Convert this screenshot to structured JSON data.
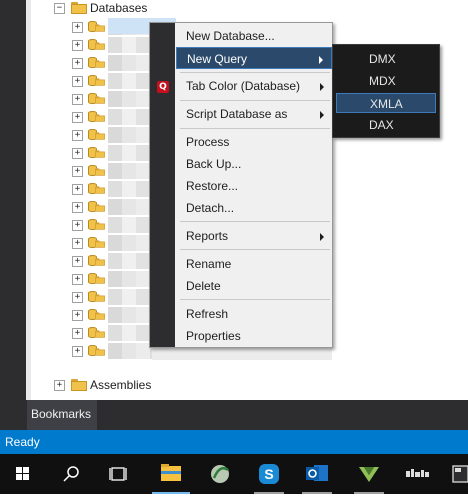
{
  "tree": {
    "databases_label": "Databases",
    "assemblies_label": "Assemblies",
    "expanded_glyph": "−",
    "collapsed_glyph": "+"
  },
  "context_menu": {
    "items": [
      {
        "label": "New Database...",
        "has_submenu": false
      },
      {
        "label": "New Query",
        "has_submenu": true,
        "highlighted": true
      },
      {
        "label": "Tab Color (Database)",
        "has_submenu": true
      },
      {
        "label": "Script Database as",
        "has_submenu": true
      },
      {
        "label": "Process",
        "has_submenu": false
      },
      {
        "label": "Back Up...",
        "has_submenu": false
      },
      {
        "label": "Restore...",
        "has_submenu": false
      },
      {
        "label": "Detach...",
        "has_submenu": false
      },
      {
        "label": "Reports",
        "has_submenu": true
      },
      {
        "label": "Rename",
        "has_submenu": false
      },
      {
        "label": "Delete",
        "has_submenu": false
      },
      {
        "label": "Refresh",
        "has_submenu": false
      },
      {
        "label": "Properties",
        "has_submenu": false
      }
    ]
  },
  "submenu": {
    "items": [
      "DMX",
      "MDX",
      "XMLA",
      "DAX"
    ],
    "highlighted": "XMLA"
  },
  "bottom": {
    "bookmarks_tab": "Bookmarks",
    "status": "Ready"
  },
  "taskbar": {
    "icons": [
      "windows-start-icon",
      "search-icon",
      "task-view-icon",
      "file-explorer-icon",
      "sql-management-studio-icon",
      "skype-icon",
      "outlook-icon",
      "visual-studio-icon",
      "remote-app-icon",
      "terminal-icon"
    ]
  },
  "colors": {
    "status_bar": "#007acc",
    "menu_highlight": "#2b4a6b",
    "dark_chrome": "#2d2d30",
    "folder": "#f0c24a"
  }
}
